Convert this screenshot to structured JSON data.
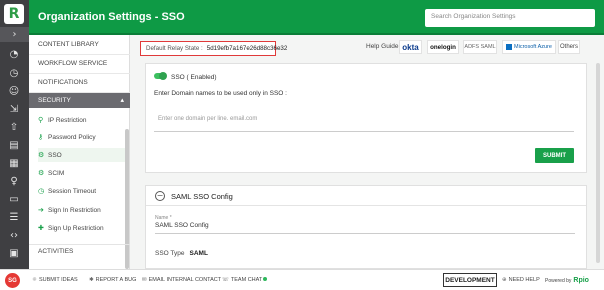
{
  "header": {
    "title": "Organization Settings - SSO",
    "search_placeholder": "Search Organization Settings"
  },
  "rail": {
    "icons": [
      "logo",
      "chevron-right-icon",
      "dashboard-icon",
      "analytics-icon",
      "people-icon",
      "import-icon",
      "upload-icon",
      "document-icon",
      "layers-icon",
      "list-icon",
      "lightbulb-icon",
      "folder-icon",
      "code-icon",
      "monitor-icon"
    ]
  },
  "nav": {
    "items": [
      {
        "label": "CONTENT LIBRARY"
      },
      {
        "label": "WORKFLOW SERVICE"
      },
      {
        "label": "NOTIFICATIONS"
      }
    ],
    "section": "SECURITY",
    "subitems": [
      {
        "label": "IP Restriction",
        "icon": "location-icon"
      },
      {
        "label": "Password Policy",
        "icon": "key-icon"
      },
      {
        "label": "SSO",
        "icon": "sso-icon",
        "active": true
      },
      {
        "label": "SCIM",
        "icon": "gears-icon"
      },
      {
        "label": "Session Timeout",
        "icon": "clock-icon"
      },
      {
        "label": "Sign In Restriction",
        "icon": "sign-in-icon"
      },
      {
        "label": "Sign Up Restriction",
        "icon": "user-plus-icon"
      }
    ],
    "activities": "ACTIVITIES"
  },
  "main": {
    "relay_label": "Default Relay State :",
    "relay_value": "5d19efb7a167e26d88c36e32",
    "help_guide": "Help Guide",
    "providers": [
      "okta",
      "onelogin",
      "ADFS SAML",
      "Microsoft Azure",
      "Others"
    ],
    "sso_toggle_label": "SSO ( Enabled)",
    "domain_label": "Enter Domain names to be used only in SSO :",
    "domain_placeholder": "Enter one domain per line. email.com",
    "submit": "SUBMIT",
    "saml": {
      "title": "SAML SSO Config",
      "name_label": "Name *",
      "name_value": "SAML SSO Config",
      "type_label": "SSO Type",
      "type_value": "SAML"
    }
  },
  "footer": {
    "avatar": "SG",
    "links": [
      "SUBMIT IDEAS",
      "REPORT A BUG",
      "EMAIL INTERNAL CONTACT",
      "TEAM CHAT"
    ],
    "env_badge": "DEVELOPMENT",
    "need_help": "NEED HELP",
    "powered_by": "Powered by",
    "powered_brand": "Rpio"
  }
}
